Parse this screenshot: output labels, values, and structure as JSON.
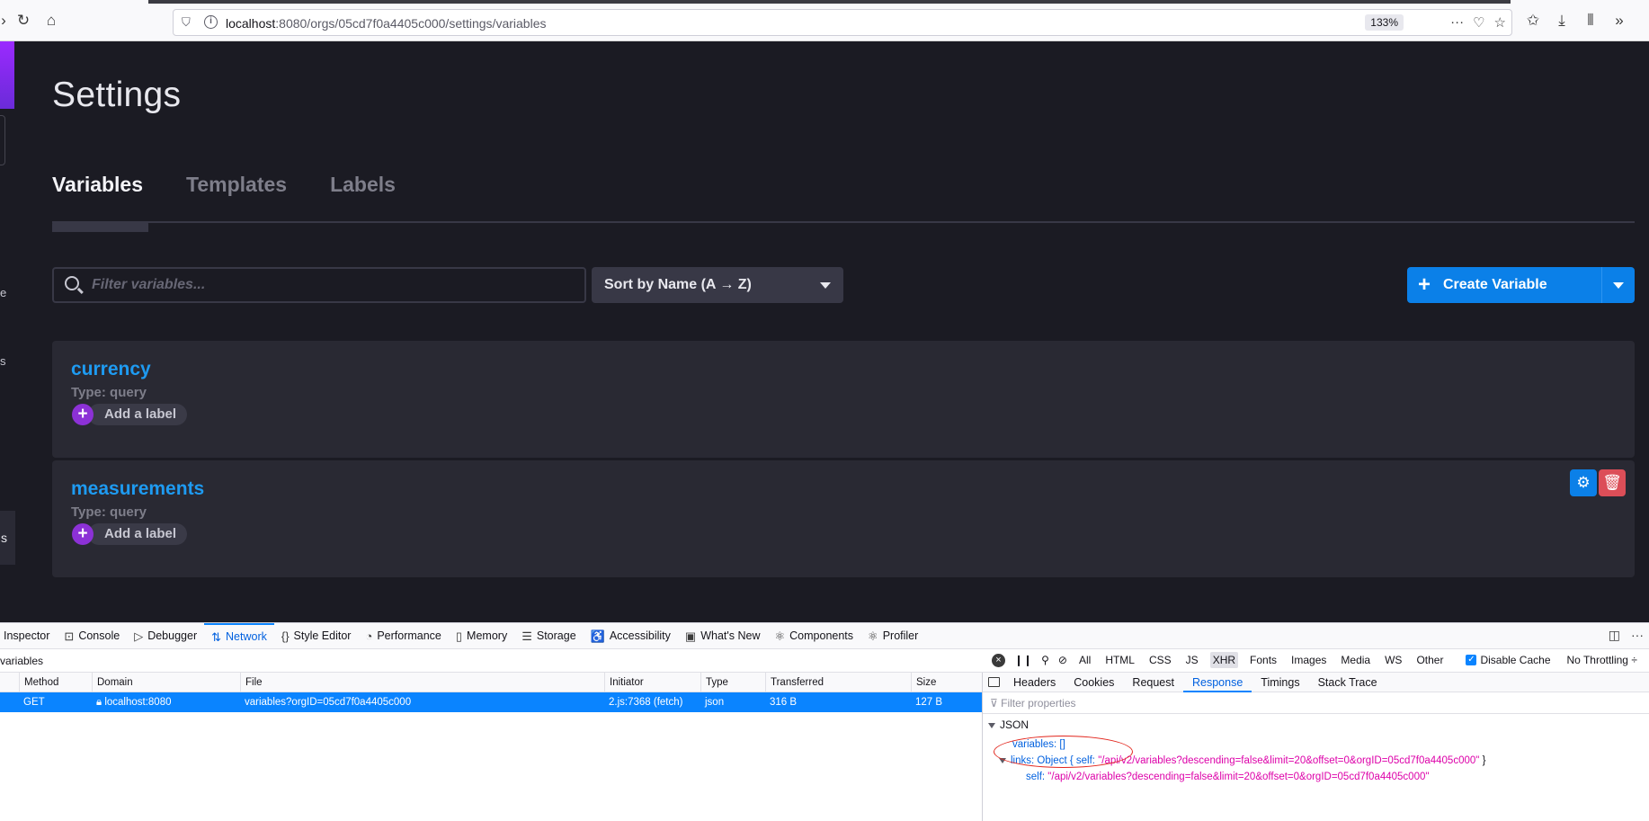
{
  "browser": {
    "url_host": "localhost",
    "url_path": ":8080/orgs/05cd7f0a4405c000/settings/variables",
    "zoom": "133%"
  },
  "page": {
    "title": "Settings",
    "tabs": [
      {
        "label": "Variables",
        "active": true
      },
      {
        "label": "Templates",
        "active": false
      },
      {
        "label": "Labels",
        "active": false
      }
    ],
    "filter_placeholder": "Filter variables...",
    "sort_label": "Sort by Name (A → Z)",
    "create_button": "Create Variable",
    "variables": [
      {
        "name": "currency",
        "type": "Type: query",
        "add_label": "Add a label"
      },
      {
        "name": "measurements",
        "type": "Type: query",
        "add_label": "Add a label"
      }
    ]
  },
  "devtools": {
    "tabs": [
      "Inspector",
      "Console",
      "Debugger",
      "Network",
      "Style Editor",
      "Performance",
      "Memory",
      "Storage",
      "Accessibility",
      "What's New",
      "Components",
      "Profiler"
    ],
    "active_tab": "Network",
    "url_filter": "variables",
    "type_filters": [
      "All",
      "HTML",
      "CSS",
      "JS",
      "XHR",
      "Fonts",
      "Images",
      "Media",
      "WS",
      "Other"
    ],
    "selected_type_filter": "XHR",
    "disable_cache": "Disable Cache",
    "throttling": "No Throttling ÷",
    "columns": [
      "Method",
      "Domain",
      "File",
      "Initiator",
      "Type",
      "Transferred",
      "Size"
    ],
    "request": {
      "method": "GET",
      "domain": "localhost:8080",
      "file": "variables?orgID=05cd7f0a4405c000",
      "initiator": "2.js:7368 (fetch)",
      "type": "json",
      "transferred": "316 B",
      "size": "127 B"
    },
    "panel_tabs": [
      "Headers",
      "Cookies",
      "Request",
      "Response",
      "Timings",
      "Stack Trace"
    ],
    "active_panel_tab": "Response",
    "filter_properties": "Filter properties",
    "json_label": "JSON",
    "json": {
      "variables_key": "variables:",
      "variables_val": "[]",
      "links_key": "links:",
      "links_obj": "Object {",
      "links_self_key": "self:",
      "links_self_val": "\"/api/v2/variables?descending=false&limit=20&offset=0&orgID=05cd7f0a4405c000\"",
      "links_close": "}",
      "self_key": "self:",
      "self_val": "\"/api/v2/variables?descending=false&limit=20&offset=0&orgID=05cd7f0a4405c000\""
    }
  }
}
